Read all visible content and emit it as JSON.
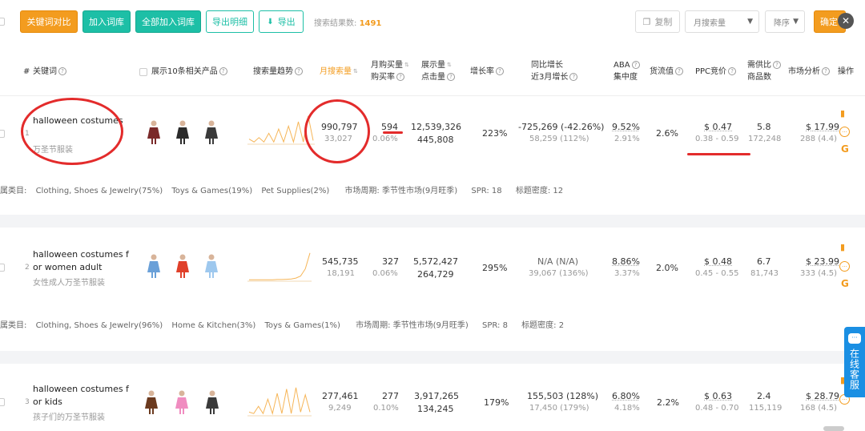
{
  "toolbar": {
    "compare_btn": "关键词对比",
    "add_lib_btn": "加入词库",
    "add_all_btn": "全部加入词库",
    "export_detail_btn": "导出明细",
    "export_btn": "导出",
    "result_label": "搜索结果数:",
    "result_count": "1491",
    "copy_btn": "复制",
    "sort_field": "月搜索量",
    "sort_order": "降序",
    "confirm_btn": "确定"
  },
  "headers": {
    "num": "#",
    "keyword": "关键词",
    "products": "展示10条相关产品",
    "trend": "搜索量趋势",
    "monthly_search": "月搜索量",
    "monthly_buy_1": "月购买量",
    "monthly_buy_2": "购买率",
    "impressions_1": "展示量",
    "impressions_2": "点击量",
    "growth": "增长率",
    "yoy_1": "同比增长",
    "yoy_2": "近3月增长",
    "aba_1": "ABA",
    "aba_2": "集中度",
    "flow": "货流值",
    "ppc": "PPC竞价",
    "supply_1": "需供比",
    "supply_2": "商品数",
    "market": "市场分析",
    "ops": "操作"
  },
  "rows": [
    {
      "index": "1",
      "keyword": "halloween costumes",
      "keyword_cn": "万圣节服装",
      "search": "990,797",
      "search_sub": "33,027",
      "buy": "594",
      "buy_rate": "0.06%",
      "impressions": "12,539,326",
      "clicks": "445,808",
      "growth": "223%",
      "yoy": "-725,269 (-42.26%)",
      "yoy_sub": "58,259 (112%)",
      "aba": "9.52%",
      "aba_sub": "2.91%",
      "flow": "2.6%",
      "ppc": "$ 0.47",
      "ppc_range": "0.38 - 0.59",
      "supply": "5.8",
      "supply_sub": "172,248",
      "market": "$ 17.99",
      "market_sub": "288 (4.4)",
      "trend": [
        0.15,
        0.05,
        0.2,
        0.05,
        0.35,
        0.05,
        0.5,
        0.05,
        0.6,
        0.05,
        0.75,
        0.05,
        0.95,
        0.1
      ],
      "categories_label": "属类目:",
      "categories": [
        "Clothing, Shoes & Jewelry(75%)",
        "Toys & Games(19%)",
        "Pet Supplies(2%)"
      ],
      "period_label": "市场周期:",
      "period": "季节性市场(9月旺季)",
      "spr_label": "SPR:",
      "spr": "18",
      "density_label": "标题密度:",
      "density": "12",
      "thumb_colors": [
        "#7a2a2a",
        "#2b2b2b",
        "#3a3a3a"
      ]
    },
    {
      "index": "2",
      "keyword": "halloween costumes for women adult",
      "keyword_cn": "女性成人万圣节服装",
      "search": "545,735",
      "search_sub": "18,191",
      "buy": "327",
      "buy_rate": "0.06%",
      "impressions": "5,572,427",
      "clicks": "264,729",
      "growth": "295%",
      "yoy": "N/A (N/A)",
      "yoy_sub": "39,067 (136%)",
      "aba": "8.86%",
      "aba_sub": "3.37%",
      "flow": "2.0%",
      "ppc": "$ 0.48",
      "ppc_range": "0.45 - 0.55",
      "supply": "6.7",
      "supply_sub": "81,743",
      "market": "$ 23.99",
      "market_sub": "333 (4.5)",
      "trend": [
        0.02,
        0.02,
        0.02,
        0.02,
        0.02,
        0.02,
        0.03,
        0.03,
        0.04,
        0.05,
        0.08,
        0.15,
        0.4,
        0.95
      ],
      "categories_label": "属类目:",
      "categories": [
        "Clothing, Shoes & Jewelry(96%)",
        "Home & Kitchen(3%)",
        "Toys & Games(1%)"
      ],
      "period_label": "市场周期:",
      "period": "季节性市场(9月旺季)",
      "spr_label": "SPR:",
      "spr": "8",
      "density_label": "标题密度:",
      "density": "2",
      "thumb_colors": [
        "#6aa0d8",
        "#e0402a",
        "#9ec8ee"
      ]
    },
    {
      "index": "3",
      "keyword": "halloween costumes for kids",
      "keyword_cn": "孩子们的万圣节服装",
      "search": "277,461",
      "search_sub": "9,249",
      "buy": "277",
      "buy_rate": "0.10%",
      "impressions": "3,917,265",
      "clicks": "134,245",
      "growth": "179%",
      "yoy": "155,503 (128%)",
      "yoy_sub": "17,450 (179%)",
      "aba": "6.80%",
      "aba_sub": "4.18%",
      "flow": "2.2%",
      "ppc": "$ 0.63",
      "ppc_range": "0.48 - 0.70",
      "supply": "2.4",
      "supply_sub": "115,119",
      "market": "$ 28.79",
      "market_sub": "168 (4.5)",
      "trend": [
        0.1,
        0.05,
        0.3,
        0.05,
        0.55,
        0.05,
        0.75,
        0.05,
        0.9,
        0.05,
        0.95,
        0.1,
        0.7,
        0.1
      ],
      "thumb_colors": [
        "#6b3a1f",
        "#f08cc0",
        "#3a3a3a"
      ]
    }
  ],
  "widget": {
    "chat_bubble": "···",
    "label": "在线客服"
  },
  "icons": {
    "bar_chart": "▮",
    "more": "···",
    "google": "G",
    "close": "✕",
    "download": "⬇",
    "copy": "❐"
  },
  "colors": {
    "accent": "#f39c1f",
    "teal": "#1dbfa6",
    "annotation": "#e32b2b",
    "widget": "#1a8fe3"
  }
}
